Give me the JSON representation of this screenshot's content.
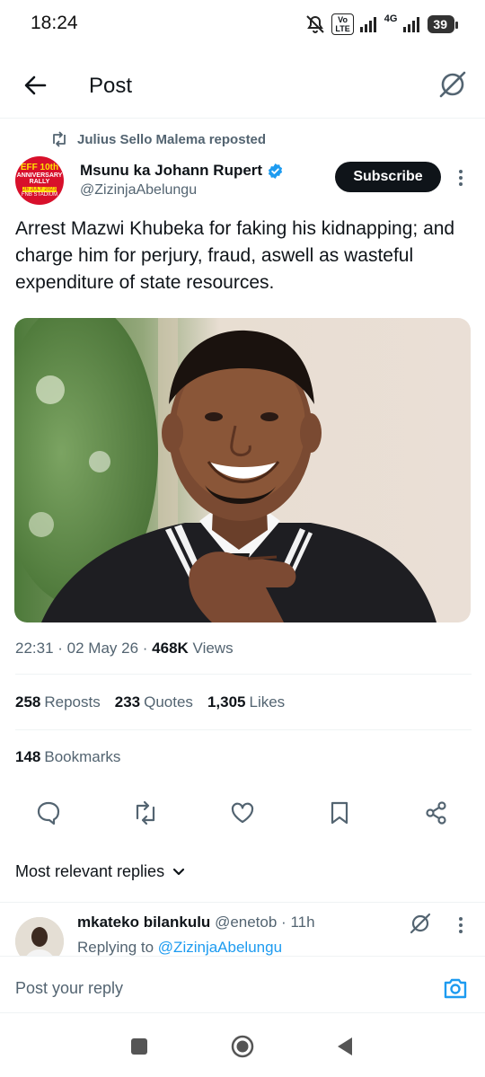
{
  "status_bar": {
    "time": "18:24",
    "volte": "Vo\nLTE",
    "network": "4G",
    "battery": "39"
  },
  "header": {
    "title": "Post"
  },
  "repost": {
    "text": "Julius Sello Malema reposted"
  },
  "author": {
    "name": "Msunu ka Johann Rupert",
    "handle": "@ZizinjaAbelungu",
    "avatar_text": {
      "line1": "EFF 10th",
      "line2": "ANNIVERSARY RALLY",
      "line3": "26 JULY 2023",
      "line4": "FNB STADIUM"
    },
    "verified_color": "#1d9bf0"
  },
  "subscribe_label": "Subscribe",
  "post": {
    "text": "Arrest Mazwi Khubeka for faking his kidnapping; and charge him for perjury, fraud, aswell as wasteful expenditure of state resources.",
    "time": "22:31",
    "date": "02 May 26",
    "views_count": "468K",
    "views_label": "Views"
  },
  "stats": {
    "reposts_count": "258",
    "reposts_label": "Reposts",
    "quotes_count": "233",
    "quotes_label": "Quotes",
    "likes_count": "1,305",
    "likes_label": "Likes",
    "bookmarks_count": "148",
    "bookmarks_label": "Bookmarks"
  },
  "replies": {
    "sort_label": "Most relevant replies",
    "items": [
      {
        "name": "mkateko bilankulu",
        "handle": "@enetob",
        "time": "11h",
        "replying_label": "Replying to",
        "replying_to": "@ZizinjaAbelungu"
      }
    ]
  },
  "composer": {
    "placeholder": "Post your reply"
  },
  "colors": {
    "accent": "#1d9bf0",
    "text": "#0f1419",
    "muted": "#536471"
  }
}
